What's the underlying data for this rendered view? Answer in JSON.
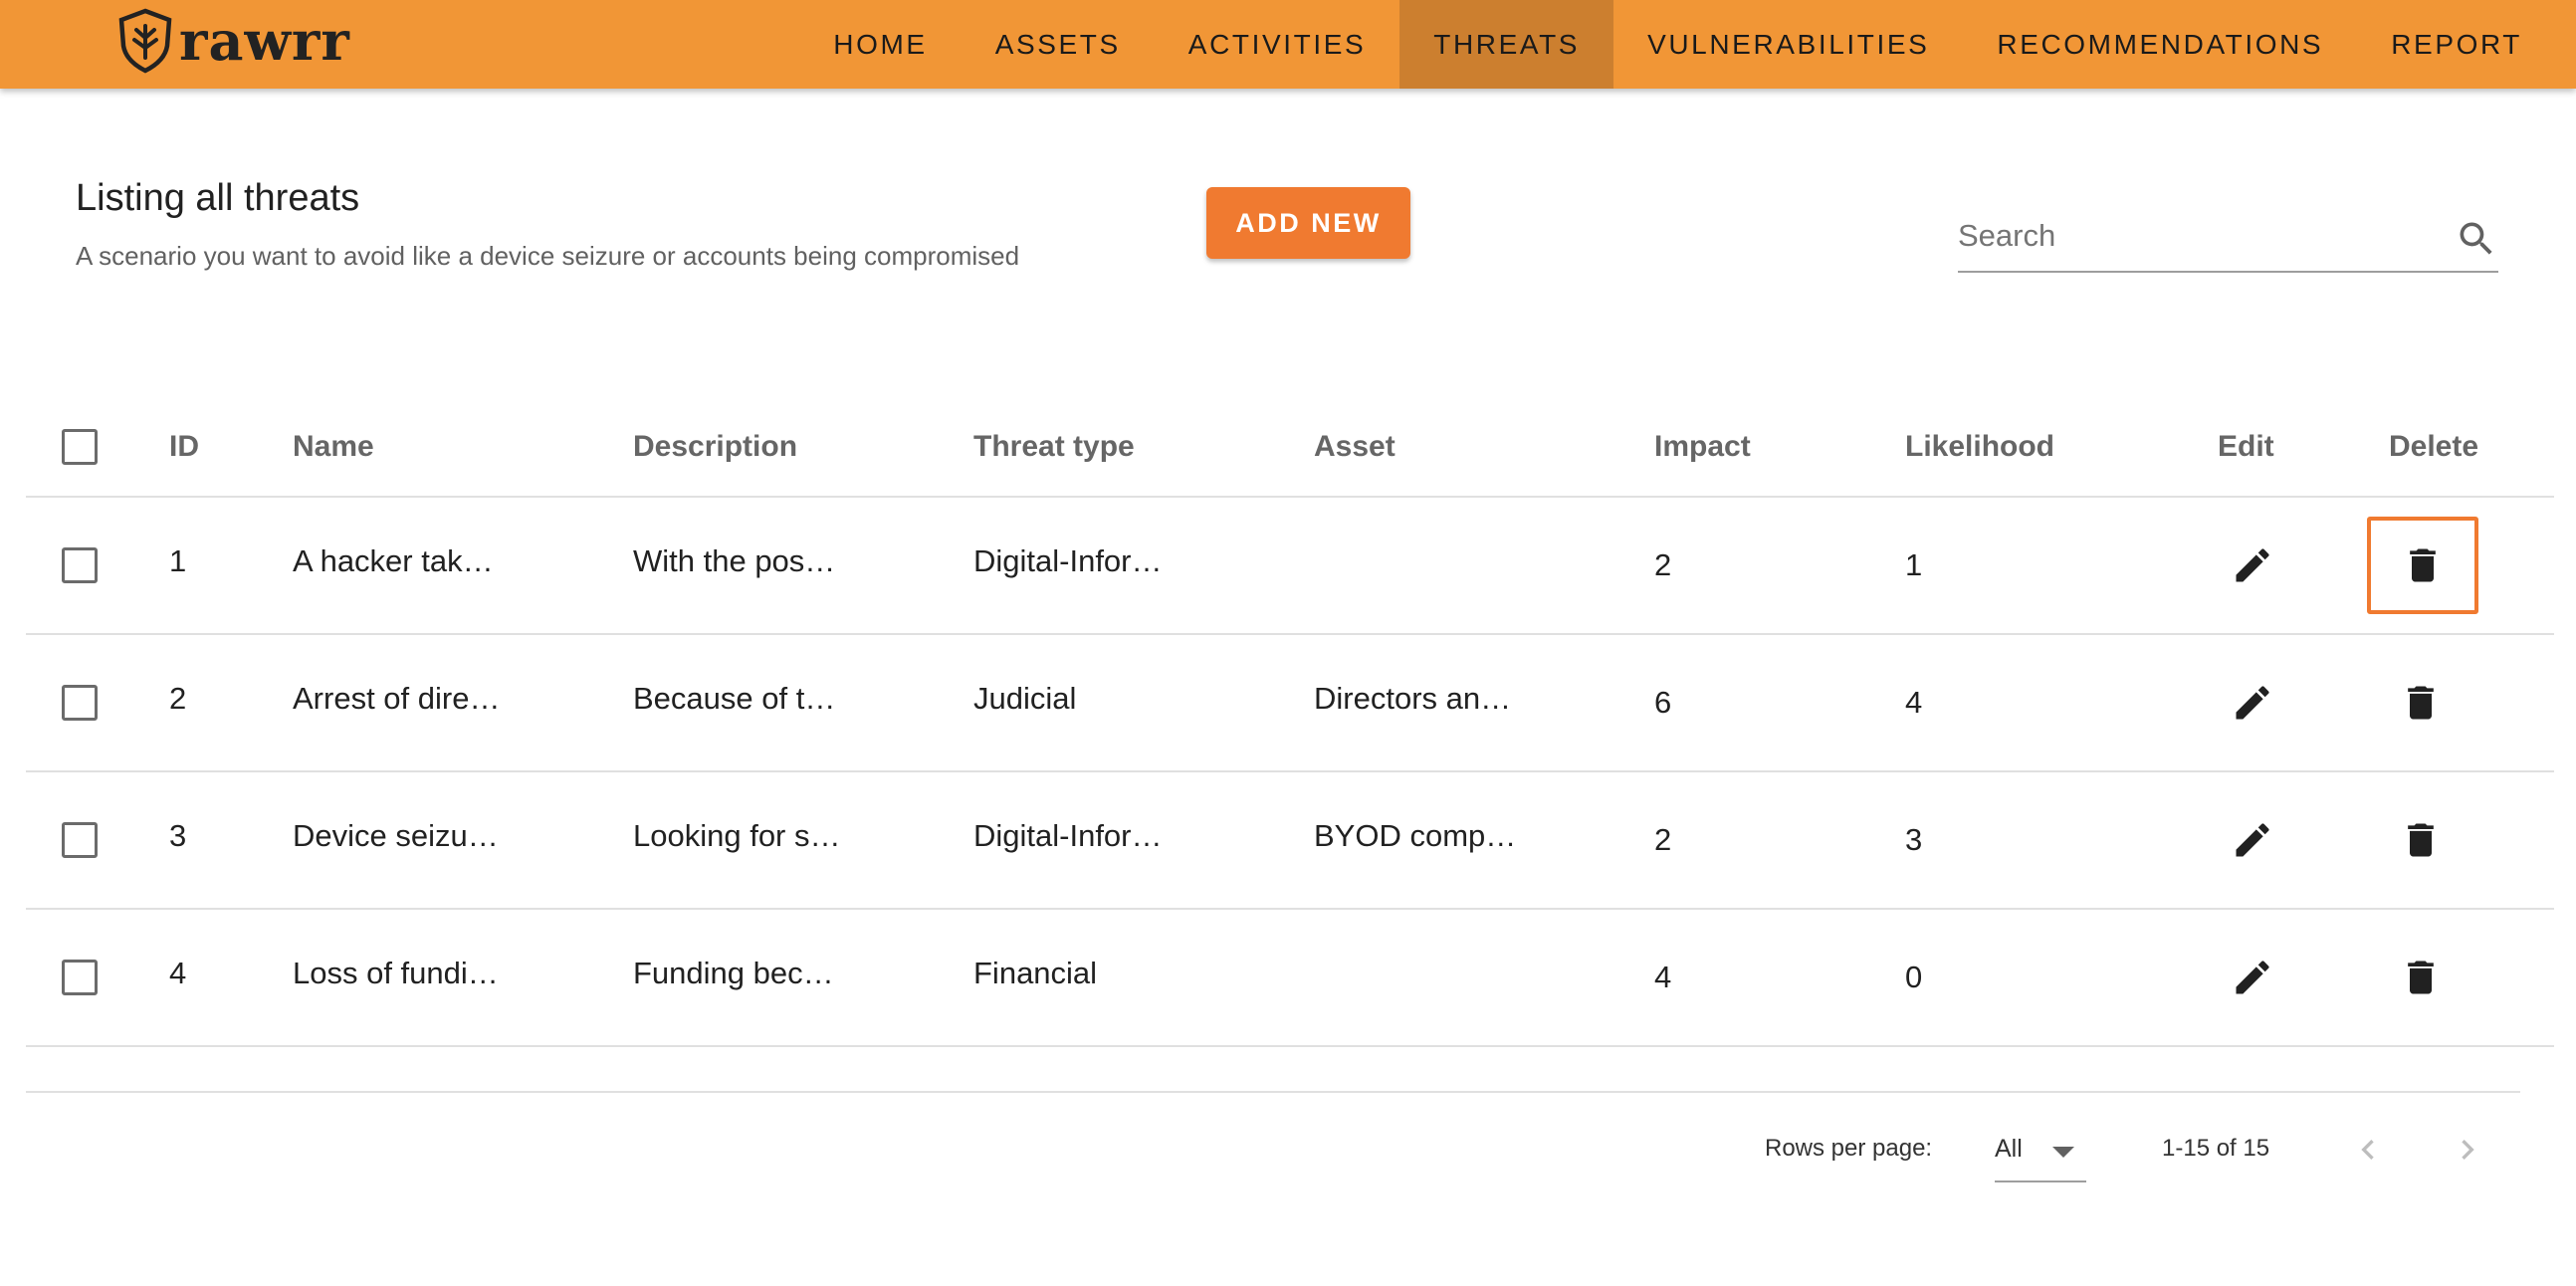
{
  "app": {
    "logo_text": "rawrr"
  },
  "nav": {
    "items": [
      {
        "label": "HOME"
      },
      {
        "label": "ASSETS"
      },
      {
        "label": "ACTIVITIES"
      },
      {
        "label": "THREATS",
        "active": true
      },
      {
        "label": "VULNERABILITIES"
      },
      {
        "label": "RECOMMENDATIONS"
      },
      {
        "label": "REPORT"
      }
    ]
  },
  "page": {
    "title": "Listing all threats",
    "subtitle": "A scenario you want to avoid like a device seizure or accounts being compromised",
    "add_new_label": "ADD NEW"
  },
  "search": {
    "placeholder": "Search",
    "value": "",
    "icon": "search-icon"
  },
  "table": {
    "headers": {
      "id": "ID",
      "name": "Name",
      "description": "Description",
      "threat_type": "Threat type",
      "asset": "Asset",
      "impact": "Impact",
      "likelihood": "Likelihood",
      "edit": "Edit",
      "delete": "Delete"
    },
    "rows": [
      {
        "id": "1",
        "name": "A hacker tak…",
        "description": "With the pos…",
        "threat_type": "Digital-Infor…",
        "asset": "",
        "impact": "2",
        "likelihood": "1"
      },
      {
        "id": "2",
        "name": "Arrest of dire…",
        "description": "Because of t…",
        "threat_type": "Judicial",
        "asset": "Directors an…",
        "impact": "6",
        "likelihood": "4"
      },
      {
        "id": "3",
        "name": "Device seizu…",
        "description": "Looking for s…",
        "threat_type": "Digital-Infor…",
        "asset": "BYOD comp…",
        "impact": "2",
        "likelihood": "3"
      },
      {
        "id": "4",
        "name": "Loss of fundi…",
        "description": "Funding bec…",
        "threat_type": "Financial",
        "asset": "",
        "impact": "4",
        "likelihood": "0"
      }
    ],
    "edit_icon": "pencil-icon",
    "delete_icon": "trash-icon"
  },
  "pagination": {
    "rows_per_page_label": "Rows per page:",
    "rows_per_page_value": "All",
    "range_text": "1-15 of 15"
  },
  "colors": {
    "topbar": "#f19636",
    "active_nav": "#cc7f2f",
    "accent": "#f07a30"
  }
}
